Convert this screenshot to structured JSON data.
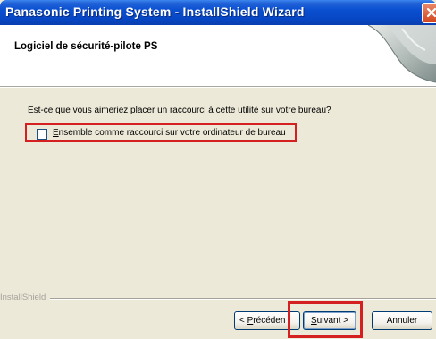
{
  "window": {
    "title": "Panasonic Printing System - InstallShield Wizard"
  },
  "header": {
    "title": "Logiciel de sécurité-pilote PS"
  },
  "body": {
    "question": "Est-ce que vous aimeriez placer un raccourci à cette utilité sur votre bureau?",
    "checkbox": {
      "mnemonic": "E",
      "label_rest": "nsemble comme raccourci sur votre ordinateur de bureau",
      "checked": false
    }
  },
  "footer": {
    "brand": "InstallShield",
    "buttons": {
      "back_mnemonic": "P",
      "back_prefix": "< ",
      "back_rest": "récéden",
      "next_mnemonic": "S",
      "next_rest": "uivant >",
      "cancel": "Annuler"
    }
  },
  "colors": {
    "titlebar": "#0a4fd0",
    "highlight": "#d42020",
    "dialog_bg": "#ece9d8"
  }
}
